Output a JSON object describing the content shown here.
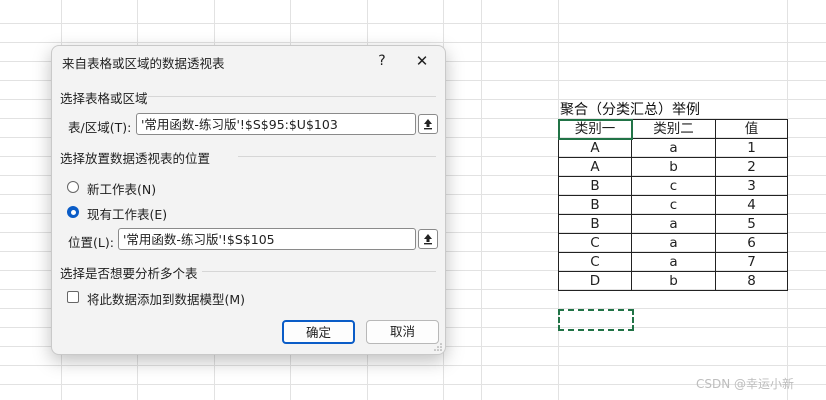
{
  "dialog": {
    "title": "来自表格或区域的数据透视表",
    "help_label": "?",
    "close_label": "✕",
    "section_source": "选择表格或区域",
    "range_label": "表/区域(T):",
    "range_value": "'常用函数-练习版'!$S$95:$U$103",
    "section_location": "选择放置数据透视表的位置",
    "option_new": "新工作表(N)",
    "option_existing": "现有工作表(E)",
    "selected_option": "existing",
    "location_label": "位置(L):",
    "location_value": "'常用函数-练习版'!$S$105",
    "section_multi": "选择是否想要分析多个表",
    "datamodel_label": "将此数据添加到数据模型(M)",
    "datamodel_checked": false,
    "ok_label": "确定",
    "cancel_label": "取消"
  },
  "sheet": {
    "title": "聚合（分类汇总）举例",
    "headers": [
      "类别一",
      "类别二",
      "值"
    ],
    "rows": [
      [
        "A",
        "a",
        "1"
      ],
      [
        "A",
        "b",
        "2"
      ],
      [
        "B",
        "c",
        "3"
      ],
      [
        "B",
        "c",
        "4"
      ],
      [
        "B",
        "a",
        "5"
      ],
      [
        "C",
        "a",
        "6"
      ],
      [
        "C",
        "a",
        "7"
      ],
      [
        "D",
        "b",
        "8"
      ]
    ]
  },
  "watermark": "CSDN @幸运小新",
  "colors": {
    "accent": "#0a5cc7",
    "excel_green": "#217346"
  }
}
